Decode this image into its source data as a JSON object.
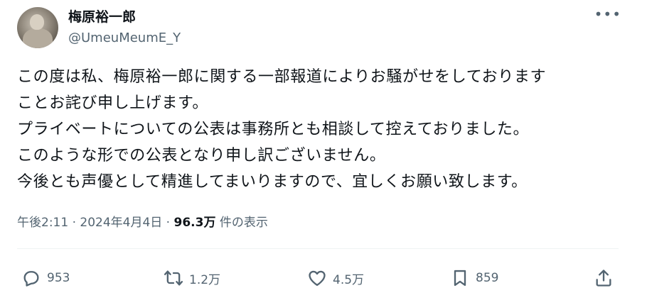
{
  "tweet": {
    "author_name": "梅原裕一郎",
    "author_handle": "@UmeuMeumE_Y",
    "more_label": "•••",
    "lines": [
      "この度は私、梅原裕一郎に関する一部報道によりお騒がせをしております",
      "ことお詫び申し上げます。",
      "プライベートについての公表は事務所とも相談して控えておりました。",
      "このような形での公表となり申し訳ございません。",
      "今後とも声優として精進してまいりますので、宜しくお願い致します。"
    ],
    "time": "午後2:11 · 2024年4月4日 · ",
    "views_count": "96.3万",
    "views_label": " 件の表示"
  },
  "actions": {
    "replies": "953",
    "retweets": "1.2万",
    "likes": "4.5万",
    "bookmarks": "859"
  },
  "icons": [
    "reply-icon",
    "retweet-icon",
    "like-icon",
    "bookmark-icon",
    "share-icon"
  ],
  "colors": {
    "text": "#0f1419",
    "secondary": "#536471",
    "divider": "#eff3f4"
  }
}
